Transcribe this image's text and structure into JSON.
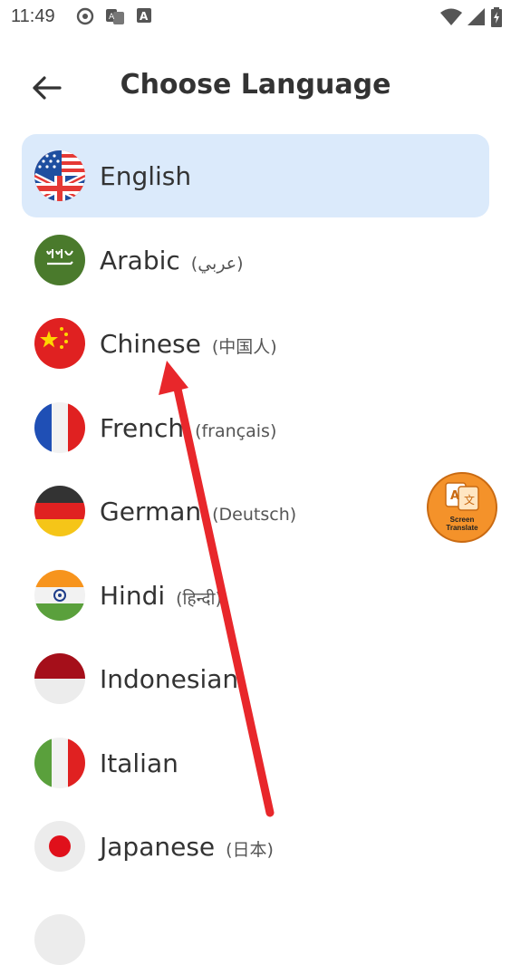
{
  "status_bar": {
    "time": "11:49"
  },
  "header": {
    "title": "Choose Language"
  },
  "languages": [
    {
      "name": "English",
      "native": ""
    },
    {
      "name": "Arabic",
      "native": "(عربي)"
    },
    {
      "name": "Chinese",
      "native": "(中国人)"
    },
    {
      "name": "French",
      "native": "(français)"
    },
    {
      "name": "German",
      "native": "(Deutsch)"
    },
    {
      "name": "Hindi",
      "native": "(हिन्दी)"
    },
    {
      "name": "Indonesian",
      "native": ""
    },
    {
      "name": "Italian",
      "native": ""
    },
    {
      "name": "Japanese",
      "native": "(日本)"
    }
  ],
  "selected_language": "English",
  "fab": {
    "label_line1": "Screen",
    "label_line2": "Translate"
  },
  "colors": {
    "selected_bg": "#dbeafb",
    "annotation_arrow": "#e8272b",
    "fab": "#f4922a"
  }
}
